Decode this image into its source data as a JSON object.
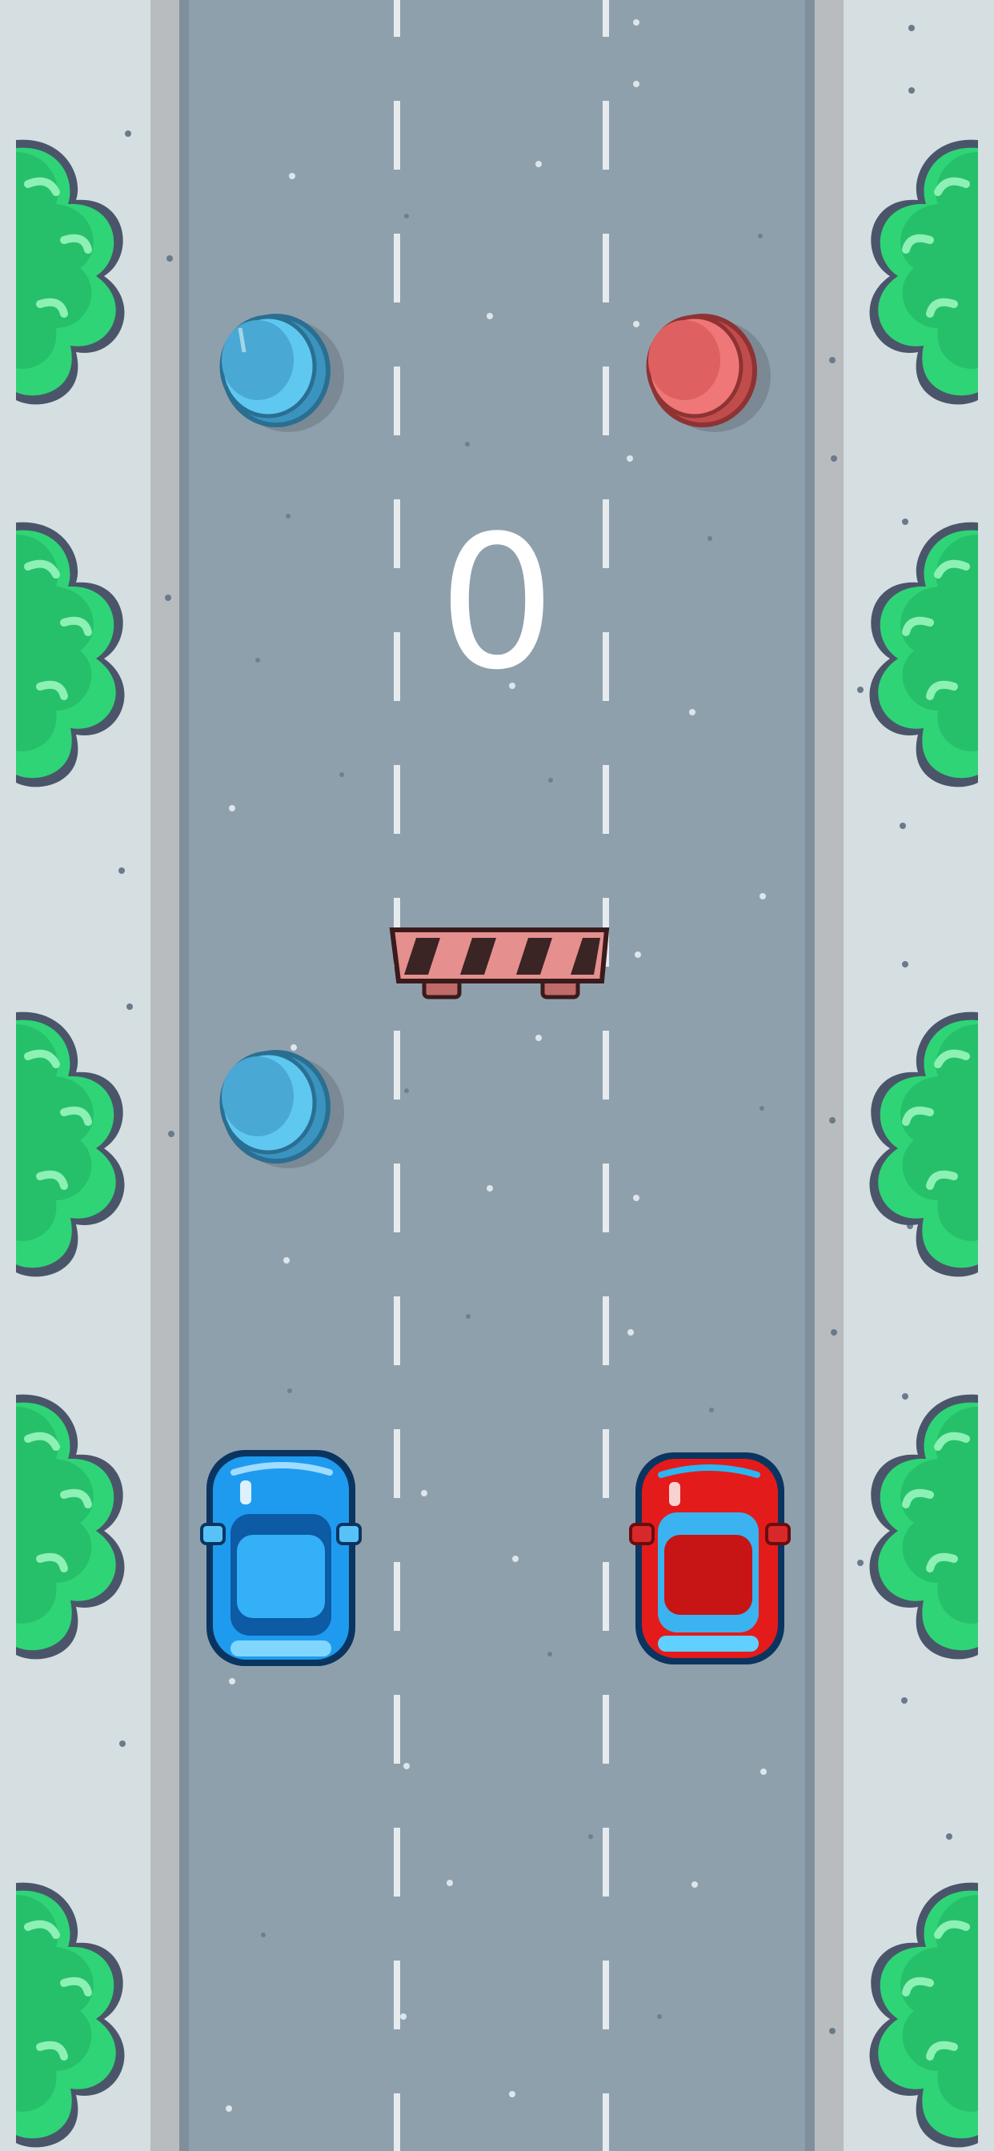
{
  "game": {
    "score": "0",
    "colors": {
      "road": "#8fa0ad",
      "sidewalk": "#d5dfe1",
      "lane_marking": "#e6ebee",
      "tree": "#2fd476",
      "blue_car": "#1e9bef",
      "red_car": "#e41b1b",
      "blue_coin": "#5fc8f0",
      "red_coin": "#f07777",
      "barrier": "#e58f8f"
    },
    "lanes": 4,
    "player_cars": [
      {
        "name": "blue-car",
        "lane": 1
      },
      {
        "name": "red-car",
        "lane": 4
      }
    ],
    "objects": [
      {
        "type": "coin",
        "color": "blue",
        "lane": 1
      },
      {
        "type": "coin",
        "color": "red",
        "lane": 4
      },
      {
        "type": "barrier",
        "lanes": [
          2,
          3
        ]
      },
      {
        "type": "coin",
        "color": "blue",
        "lane": 1
      }
    ]
  }
}
